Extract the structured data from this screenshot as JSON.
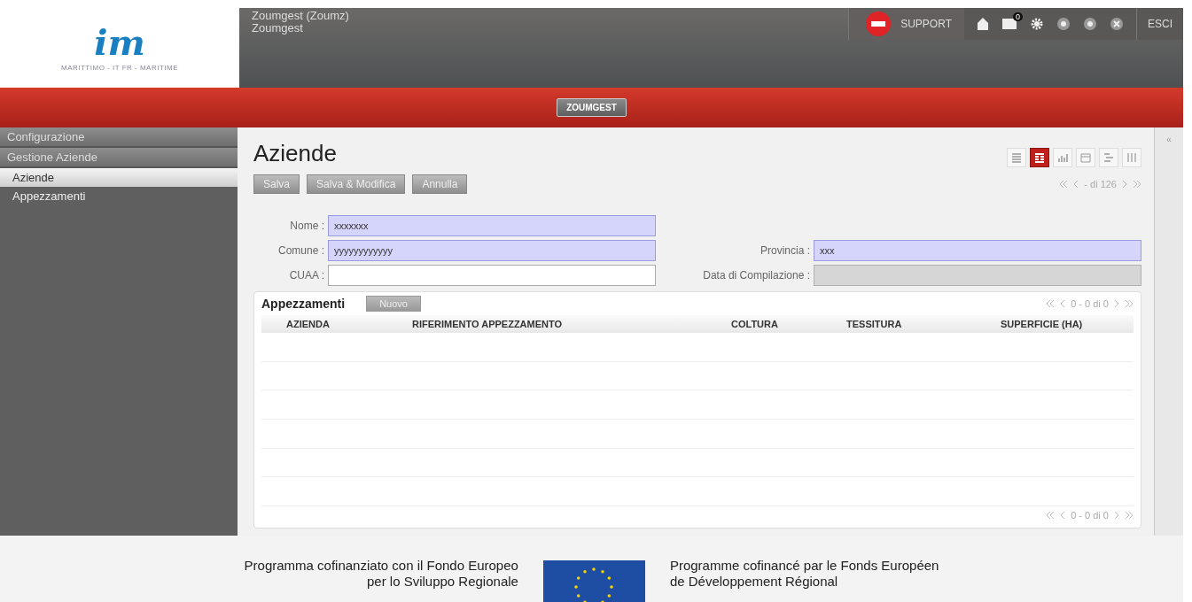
{
  "logo": {
    "mark": "im",
    "caption": "MARITTIMO - IT FR - MARITIME"
  },
  "header": {
    "title": "Zoumgest (Zoumz)",
    "subtitle": "Zoumgest",
    "support": "SUPPORT",
    "badge": "0",
    "logout": "ESCI"
  },
  "menu_bar": {
    "items": [
      {
        "label": "ZOUMGEST",
        "selected": true
      }
    ]
  },
  "sidebar": {
    "sections": [
      {
        "label": "Configurazione"
      },
      {
        "label": "Gestione Aziende",
        "children": [
          {
            "label": "Aziende",
            "selected": true
          },
          {
            "label": "Appezzamenti",
            "selected": false
          }
        ]
      }
    ]
  },
  "page": {
    "title": "Aziende",
    "collapse": "«"
  },
  "view_switcher": [
    {
      "kind": "list",
      "selected": false
    },
    {
      "kind": "form",
      "selected": true
    },
    {
      "kind": "chart",
      "selected": false
    },
    {
      "kind": "calendar",
      "selected": false
    },
    {
      "kind": "gantt",
      "selected": false
    },
    {
      "kind": "columns",
      "selected": false
    }
  ],
  "toolbar": {
    "buttons": [
      "Salva",
      "Salva & Modifica",
      "Annulla"
    ],
    "pager": "- di 126"
  },
  "form": {
    "rows": [
      [
        {
          "label": "Nome :",
          "value": "xxxxxxx",
          "required": true,
          "disabled": false
        }
      ],
      [
        {
          "label": "Comune :",
          "value": "yyyyyyyyyyyy",
          "required": true,
          "disabled": false
        },
        {
          "label": "Provincia :",
          "value": "xxx",
          "required": true,
          "disabled": false
        }
      ],
      [
        {
          "label": "CUAA :",
          "required": false,
          "disabled": false
        },
        {
          "label": "Data di Compilazione :",
          "required": false,
          "disabled": true
        }
      ]
    ]
  },
  "subgrid": {
    "title": "Appezzamenti",
    "new_button": "Nuovo",
    "pager_top": "0 - 0 di 0",
    "pager_bottom": "0 - 0 di 0",
    "columns": [
      "AZIENDA",
      "RIFERIMENTO APPEZZAMENTO",
      "COLTURA",
      "TESSITURA",
      "SUPERFICIE (HA)"
    ]
  },
  "footer": {
    "left": [
      "Programma cofinanziato con il Fondo Europeo",
      "per lo Sviluppo Regionale"
    ],
    "right": [
      "Programme cofinancé par le Fonds Européen",
      "de Développement Régional"
    ]
  }
}
